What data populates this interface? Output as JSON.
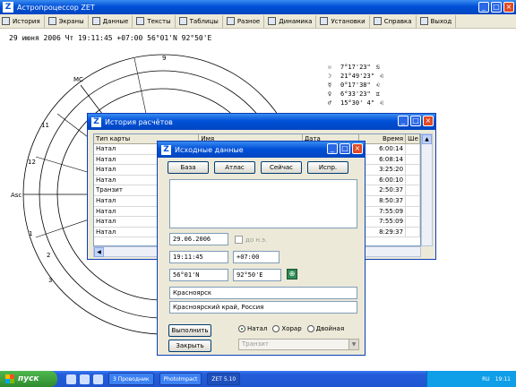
{
  "app": {
    "title": "Астропроцессор ZET",
    "icon_letter": "Z"
  },
  "menu": [
    {
      "label": "История",
      "icon": "history-icon"
    },
    {
      "label": "Экраны",
      "icon": "screens-icon"
    },
    {
      "label": "Данные",
      "icon": "data-icon"
    },
    {
      "label": "Тексты",
      "icon": "texts-icon"
    },
    {
      "label": "Таблицы",
      "icon": "tables-icon"
    },
    {
      "label": "Разное",
      "icon": "misc-icon"
    },
    {
      "label": "Динамика",
      "icon": "dynamics-icon"
    },
    {
      "label": "Установки",
      "icon": "settings-icon"
    },
    {
      "label": "Справка",
      "icon": "help-icon"
    },
    {
      "label": "Выход",
      "icon": "exit-icon"
    }
  ],
  "info_line": "29 июня 2006 Чт   19:11:45 +07:00 56°01'N   92°50'E",
  "chart": {
    "house_numbers": [
      "9",
      "11",
      "12",
      "1",
      "2",
      "3"
    ],
    "labels": [
      "MC",
      "Asc"
    ]
  },
  "planets": [
    {
      "symbol": "☉",
      "text": "7°17'23\"",
      "sign": "♋"
    },
    {
      "symbol": "☽",
      "text": "21°49'23\"",
      "sign": "♌"
    },
    {
      "symbol": "☿",
      "text": "0°17'38\"",
      "sign": "♌"
    },
    {
      "symbol": "♀",
      "text": "6°33'23\"",
      "sign": "♊"
    },
    {
      "symbol": "♂",
      "text": "15°30' 4\"",
      "sign": "♌"
    }
  ],
  "history": {
    "title": "История расчётов",
    "columns": [
      "Тип карты",
      "Имя",
      "Дата",
      "Время",
      "Ше"
    ],
    "rows": [
      {
        "type": "Натал",
        "time": "6:00:14"
      },
      {
        "type": "Натал",
        "time": "6:08:14"
      },
      {
        "type": "Натал",
        "time": "3:25:20"
      },
      {
        "type": "Натал",
        "time": "6:00:10"
      },
      {
        "type": "Транзит",
        "time": "2:50:37"
      },
      {
        "type": "Натал",
        "time": "8:50:37"
      },
      {
        "type": "Натал",
        "time": "7:55:09"
      },
      {
        "type": "Натал",
        "time": "7:55:09"
      },
      {
        "type": "Натал",
        "time": "8:29:37"
      }
    ]
  },
  "input": {
    "title": "Исходные данные",
    "buttons": [
      "База",
      "Атлас",
      "Сейчас",
      "Испр."
    ],
    "date": "29.06.2006",
    "bc_label": "до н.э.",
    "time": "19:11:45",
    "timezone": "+07:00",
    "latitude": "56°01'N",
    "longitude": "92°50'E",
    "city": "Красноярск",
    "region": "Красноярский край, Россия",
    "execute_label": "Выполнить",
    "close_label": "Закрыть",
    "chart_types": [
      {
        "label": "Натал",
        "selected": true
      },
      {
        "label": "Хорар",
        "selected": false
      },
      {
        "label": "Двойная",
        "selected": false
      }
    ],
    "transit_select": "Транзит"
  },
  "taskbar": {
    "start_label": "пуск",
    "items": [
      "3 Проводник",
      "PhotoImpact",
      "ZET 5.10"
    ],
    "tray_lang": "RU",
    "clock": "19:11"
  }
}
